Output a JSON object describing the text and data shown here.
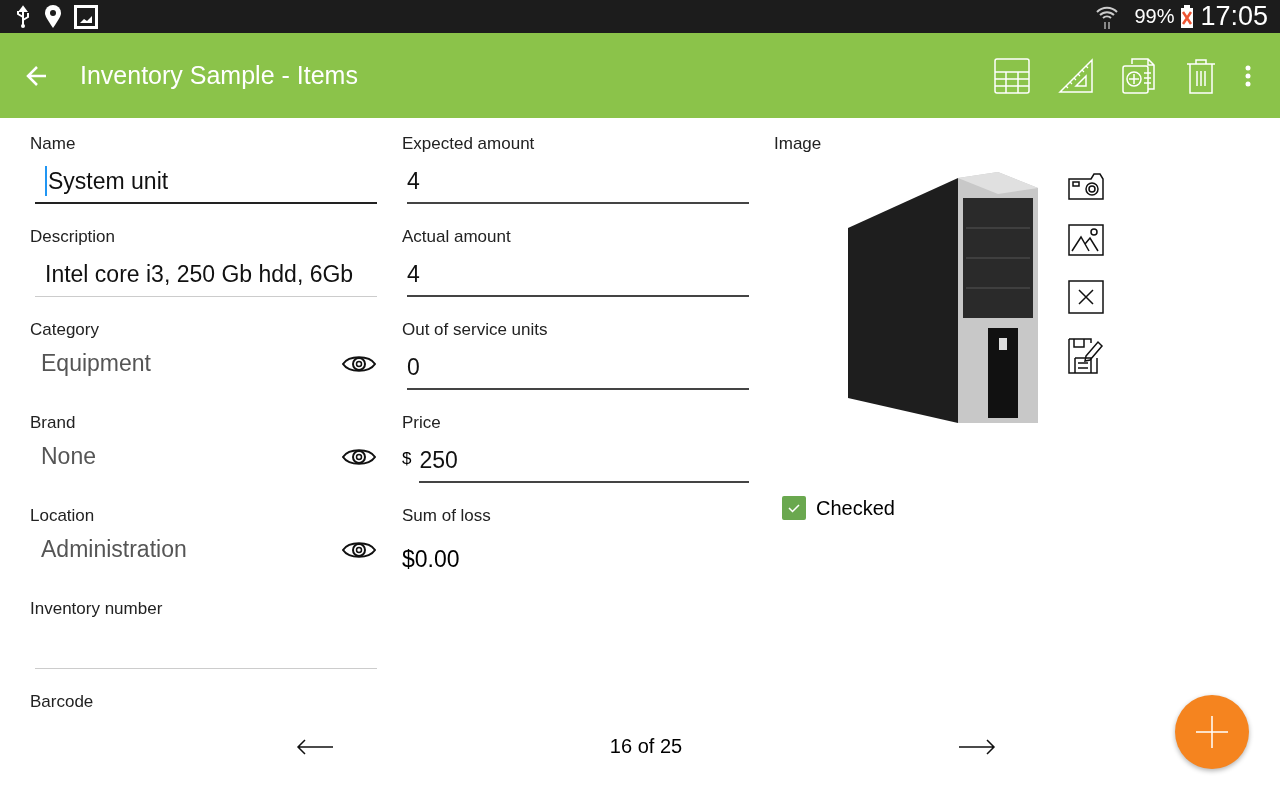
{
  "status_bar": {
    "battery": "99%",
    "time": "17:05"
  },
  "app_bar": {
    "title": "Inventory Sample - Items"
  },
  "left_fields": [
    {
      "kind": "text",
      "label": "Name",
      "value": "System unit",
      "focused": true
    },
    {
      "kind": "text",
      "label": "Description",
      "value": "Intel core i3, 250 Gb hdd, 6Gb",
      "focused": false
    },
    {
      "kind": "picker",
      "label": "Category",
      "value": "Equipment"
    },
    {
      "kind": "picker",
      "label": "Brand",
      "value": "None"
    },
    {
      "kind": "picker",
      "label": "Location",
      "value": "Administration"
    },
    {
      "kind": "text",
      "label": "Inventory number",
      "focused": false
    },
    {
      "kind": "label",
      "label": "Barcode"
    }
  ],
  "middle_fields": [
    {
      "kind": "number",
      "label": "Expected amount",
      "value": "4"
    },
    {
      "kind": "number",
      "label": "Actual amount",
      "value": "4"
    },
    {
      "kind": "number",
      "label": "Out of service units",
      "value": "0"
    },
    {
      "kind": "money",
      "label": "Price",
      "currency": "$",
      "value": "250"
    },
    {
      "kind": "readonly",
      "label": "Sum of loss",
      "value": "$0.00"
    }
  ],
  "image": {
    "label": "Image",
    "checkbox": {
      "label": "Checked",
      "checked": true
    }
  },
  "pager": {
    "text": "16 of 25"
  }
}
